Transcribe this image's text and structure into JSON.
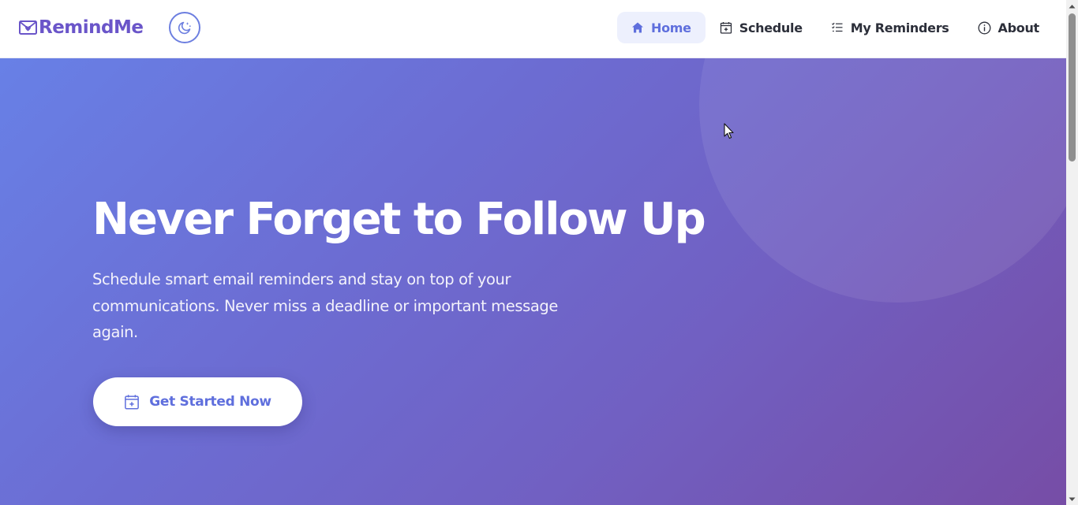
{
  "brand": {
    "name": "RemindMe",
    "accent": "#6a55c9"
  },
  "theme_toggle": {
    "icon": "moon-stars-icon"
  },
  "nav": {
    "active_bg": "#edf0fd",
    "active_color": "#5f6fdd",
    "items": [
      {
        "label": "Home",
        "icon": "home-icon",
        "active": true
      },
      {
        "label": "Schedule",
        "icon": "calendar-plus-icon",
        "active": false
      },
      {
        "label": "My Reminders",
        "icon": "list-check-icon",
        "active": false
      },
      {
        "label": "About",
        "icon": "info-circle-icon",
        "active": false
      }
    ]
  },
  "hero": {
    "title": "Never Forget to Follow Up",
    "subtitle": "Schedule smart email reminders and stay on top of your communications. Never miss a deadline or important message again.",
    "cta_label": "Get Started Now",
    "cta_icon": "calendar-plus-icon",
    "gradient_start": "#6880e6",
    "gradient_end": "#764da6"
  }
}
